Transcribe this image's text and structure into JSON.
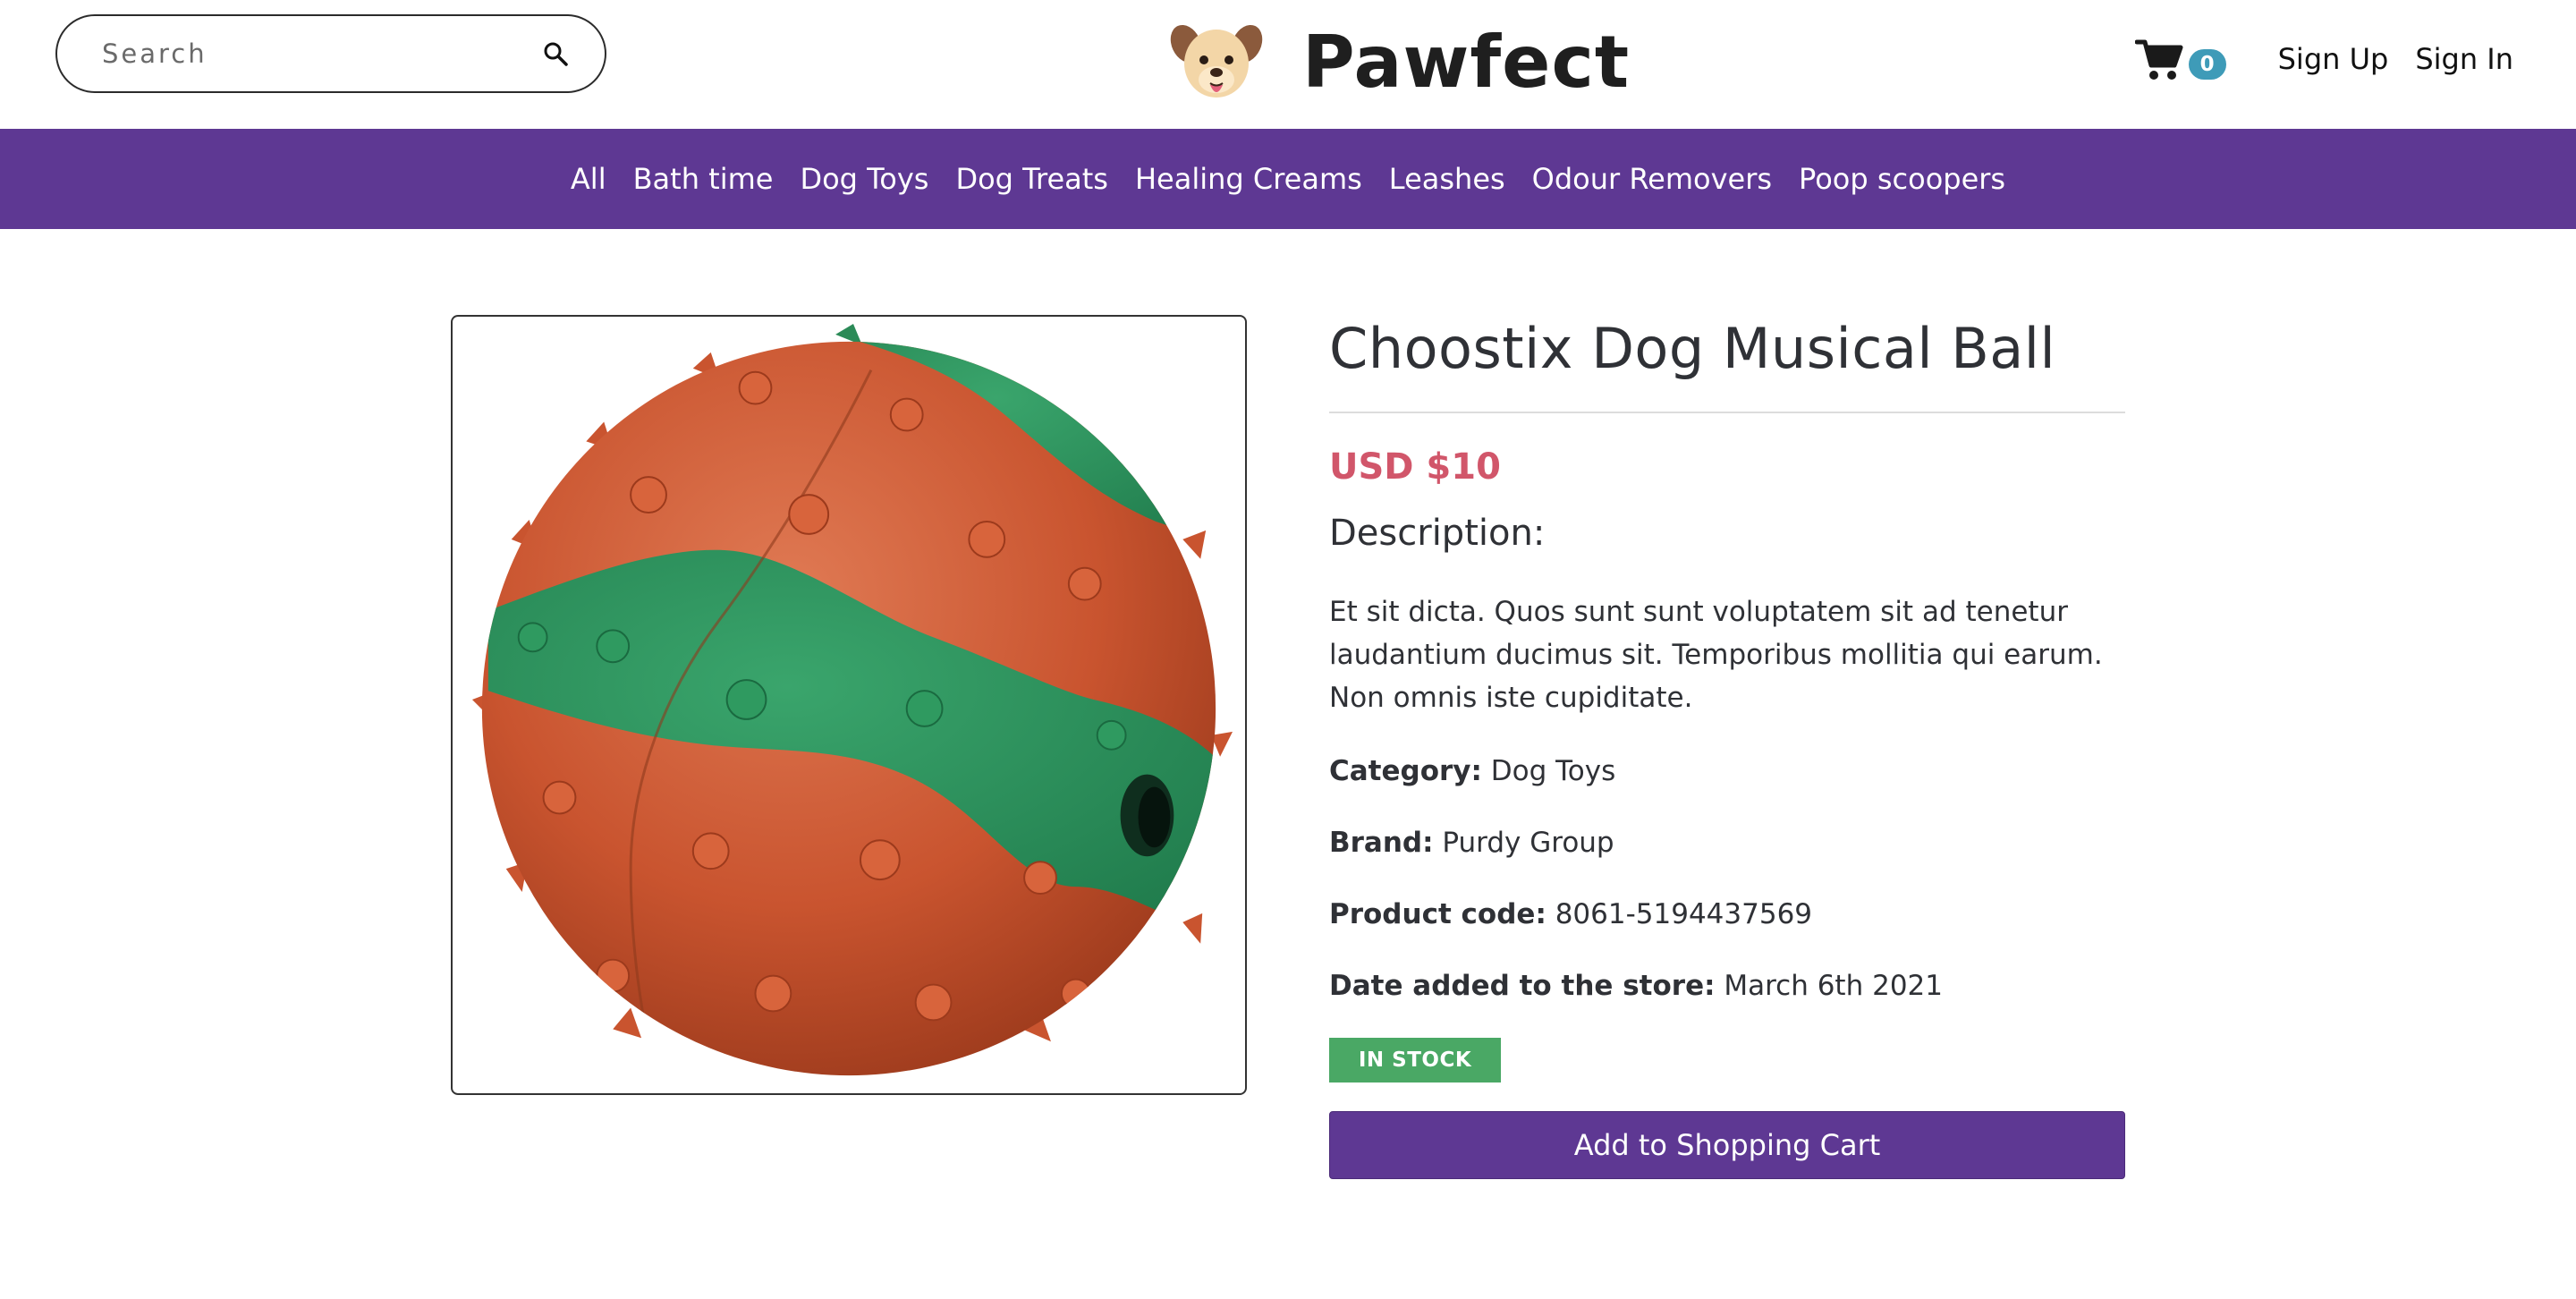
{
  "search": {
    "placeholder": "Search"
  },
  "brand": {
    "name": "Pawfect"
  },
  "header": {
    "cart_count": "0",
    "sign_up_label": "Sign Up",
    "sign_in_label": "Sign In"
  },
  "nav": {
    "items": [
      {
        "label": "All"
      },
      {
        "label": "Bath time"
      },
      {
        "label": "Dog Toys"
      },
      {
        "label": "Dog Treats"
      },
      {
        "label": "Healing Creams"
      },
      {
        "label": "Leashes"
      },
      {
        "label": "Odour Removers"
      },
      {
        "label": "Poop scoopers"
      }
    ]
  },
  "product": {
    "title": "Choostix Dog Musical Ball",
    "price": "USD $10",
    "description_heading": "Description:",
    "description": "Et sit dicta. Quos sunt sunt voluptatem sit ad tenetur laudantium ducimus sit. Temporibus mollitia qui earum. Non omnis iste cupiditate.",
    "category_label": "Category:",
    "category": "Dog Toys",
    "brand_label": "Brand:",
    "brand": "Purdy Group",
    "code_label": "Product code:",
    "code": "8061-5194437569",
    "date_label": "Date added to the store:",
    "date": "March 6th 2021",
    "stock_status": "IN STOCK",
    "add_to_cart_label": "Add to Shopping Cart"
  },
  "colors": {
    "nav_background": "#5e3893",
    "price": "#d1566a",
    "stock_badge": "#4aa865",
    "cart_badge": "#3e9bb8",
    "button": "#5e3893"
  },
  "icons": {
    "search": "search-icon",
    "logo": "dog-face-icon",
    "cart": "shopping-cart-icon"
  }
}
